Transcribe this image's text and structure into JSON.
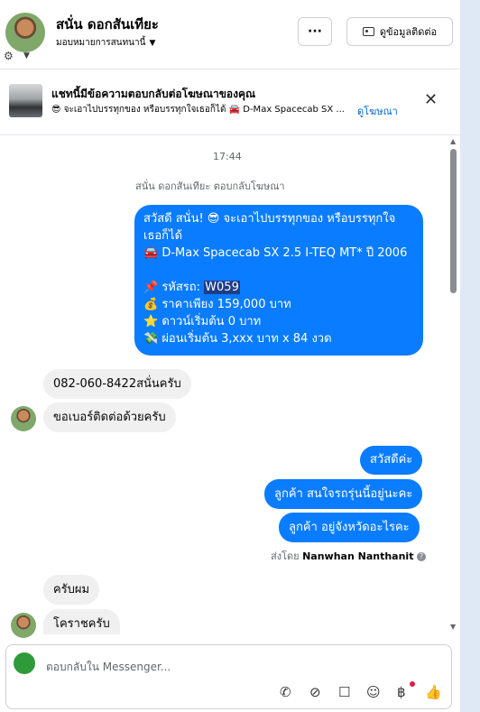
{
  "header": {
    "name": "สนั่น ดอกสันเทียะ",
    "assign": "มอบหมายการสนทนานี้",
    "more": "···",
    "contact_button": "ดูข้อมูลติดต่อ"
  },
  "ad": {
    "title": "แชทนี้มีข้อความตอบกลับต่อโฆษณาของคุณ",
    "desc": "😎 จะเอาไปบรรทุกของ หรือบรรทุกใจเธอก็ได้ 🚘 D-Max Spacecab SX ...",
    "link": "ดูโฆษณา",
    "close": "✕"
  },
  "chat": {
    "time": "17:44",
    "replied_note": "สนั่น ดอกสันเทียะ ตอบกลับโฆษณา",
    "ad_message": {
      "line1": "สวัสดี สนั่น! 😎 จะเอาไปบรรทุกของ หรือบรรทุกใจ",
      "line2": "เธอก็ได้",
      "line3": "🚘 D-Max Spacecab SX 2.5 I-TEQ MT* ปี 2006",
      "line5_prefix": "📌 รหัสรถ: ",
      "line5_code": "W059",
      "line6": "💰 ราคาเพียง 159,000 บาท",
      "line7": "⭐ ดาวน์เริ่มต้น 0 บาท",
      "line8": "💸 ผ่อนเริ่มต้น 3,xxx บาท x 84 งวด"
    },
    "in1": "082-060-8422สนั่นครับ",
    "in2": "ขอเบอร์ติดต่อด้วยครับ",
    "out1": "สวัสดีค่ะ",
    "out2": "ลูกค้า สนใจรถรุ่นนี้อยู่นะคะ",
    "out3": "ลูกค้า อยู่จังหวัดอะไรคะ",
    "sent_by_label": "ส่งโดย",
    "sent_by_name": "Nanwhan Nanthanit",
    "in3": "ครับผม",
    "in4": "โคราชครับ"
  },
  "composer": {
    "placeholder": "ตอบกลับใน Messenger..."
  },
  "colors": {
    "accent": "#0a7cff",
    "link": "#0064d1"
  }
}
